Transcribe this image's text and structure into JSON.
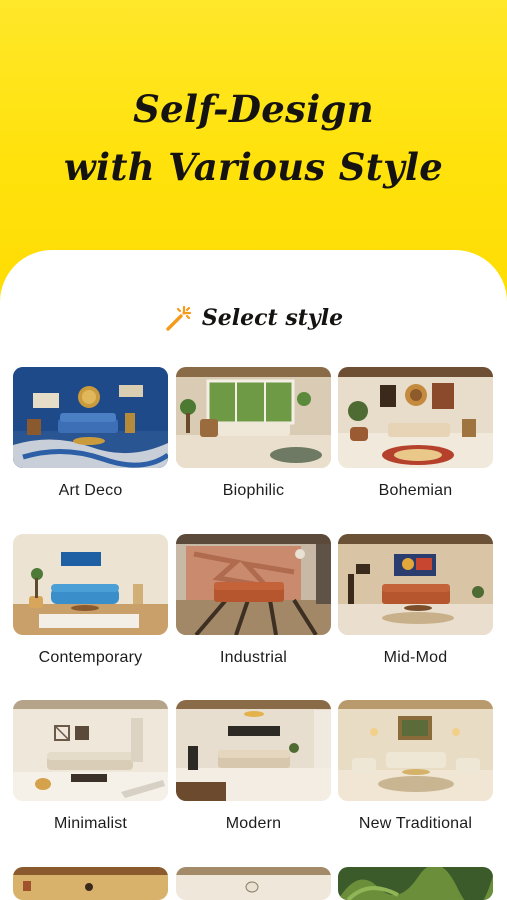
{
  "hero": {
    "title_line1": "Self-Design",
    "title_line2": "with Various Style"
  },
  "section": {
    "select_label": "Select style",
    "icon": "magic-wand-icon"
  },
  "styles": [
    {
      "label": "Art Deco"
    },
    {
      "label": "Biophilic"
    },
    {
      "label": "Bohemian"
    },
    {
      "label": "Contemporary"
    },
    {
      "label": "Industrial"
    },
    {
      "label": "Mid-Mod"
    },
    {
      "label": "Minimalist"
    },
    {
      "label": "Modern"
    },
    {
      "label": "New Traditional"
    }
  ],
  "colors": {
    "hero_background": "#FFE30F",
    "accent_orange": "#F59A1A",
    "text": "#151311"
  }
}
